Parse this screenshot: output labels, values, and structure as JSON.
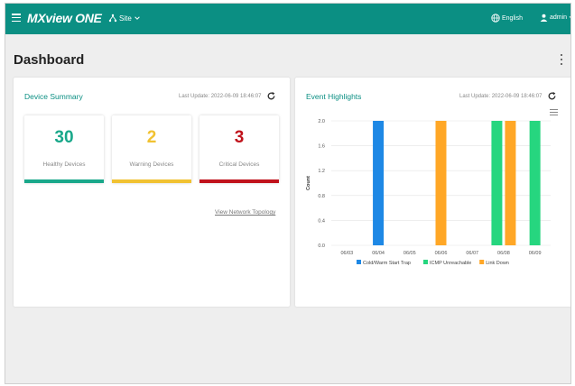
{
  "header": {
    "brand": "MXview ONE",
    "site_label": "Site",
    "language": "English",
    "user": "admin"
  },
  "page": {
    "title": "Dashboard"
  },
  "device_summary": {
    "title": "Device Summary",
    "last_update": "Last Update: 2022-06-09 18:46:07",
    "stats": [
      {
        "value": "30",
        "label": "Healthy Devices",
        "color": "#19a88a"
      },
      {
        "value": "2",
        "label": "Warning Devices",
        "color": "#f1c232"
      },
      {
        "value": "3",
        "label": "Critical Devices",
        "color": "#c0121b"
      }
    ],
    "link": "View Network Topology"
  },
  "event_highlights": {
    "title": "Event Highlights",
    "last_update": "Last Update: 2022-06-09 18:46:07"
  },
  "chart_data": {
    "type": "bar",
    "categories": [
      "06/03",
      "06/04",
      "06/05",
      "06/06",
      "06/07",
      "06/08",
      "06/09"
    ],
    "series": [
      {
        "name": "Cold/Warm Start Trap",
        "color": "#1e88e5",
        "values": [
          0,
          2,
          0,
          0,
          0,
          0,
          0
        ]
      },
      {
        "name": "ICMP Unreachable",
        "color": "#26d67f",
        "values": [
          0,
          0,
          0,
          0,
          0,
          2,
          2
        ]
      },
      {
        "name": "Link Down",
        "color": "#ffa726",
        "values": [
          0,
          0,
          0,
          2,
          0,
          2,
          0
        ]
      }
    ],
    "ylabel": "Count",
    "ylim": [
      0,
      2.0
    ],
    "yticks": [
      "0.0",
      "0.4",
      "0.8",
      "1.2",
      "1.6",
      "2.0"
    ],
    "grid": true,
    "legend": "bottom"
  }
}
